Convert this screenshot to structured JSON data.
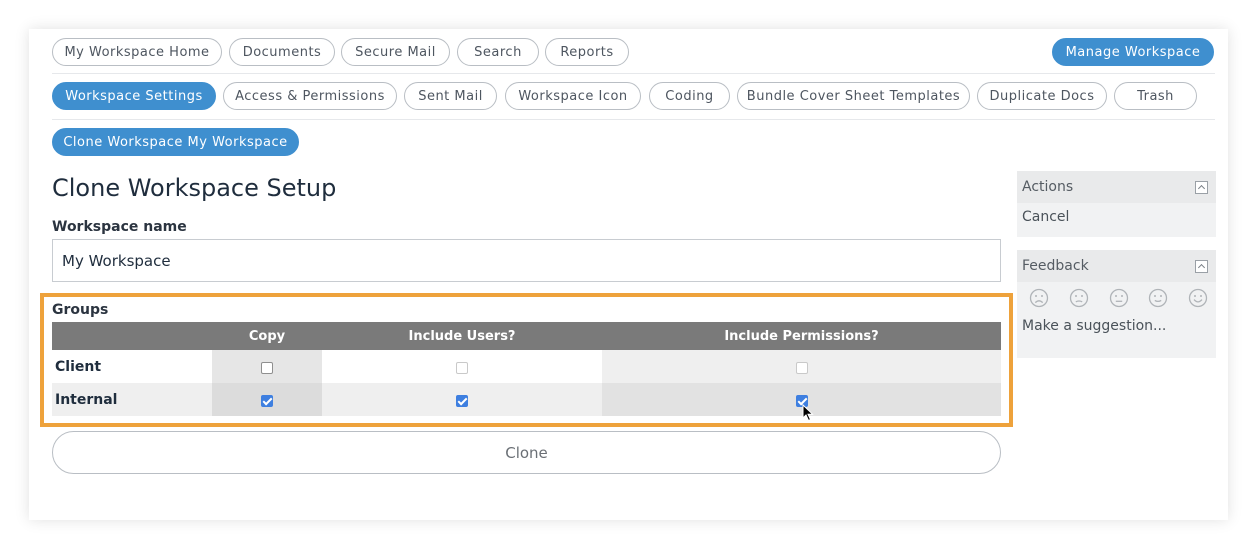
{
  "nav_row1": {
    "tabs": [
      "My Workspace Home",
      "Documents",
      "Secure Mail",
      "Search",
      "Reports"
    ],
    "manage_button": "Manage Workspace"
  },
  "nav_row2": {
    "tabs": [
      "Workspace Settings",
      "Access & Permissions",
      "Sent Mail",
      "Workspace Icon",
      "Coding",
      "Bundle Cover Sheet Templates",
      "Duplicate Docs",
      "Trash"
    ],
    "active": "Workspace Settings"
  },
  "nav_row3": {
    "tab": "Clone Workspace My Workspace"
  },
  "main": {
    "title": "Clone Workspace Setup",
    "workspace_name_label": "Workspace name",
    "workspace_name_value": "My Workspace",
    "groups_label": "Groups",
    "table": {
      "headers": [
        "",
        "Copy",
        "Include Users?",
        "Include Permissions?"
      ],
      "rows": [
        {
          "name": "Client",
          "copy": false,
          "include_users": false,
          "include_permissions": false
        },
        {
          "name": "Internal",
          "copy": true,
          "include_users": true,
          "include_permissions": true
        }
      ]
    },
    "clone_button": "Clone"
  },
  "actions_panel": {
    "title": "Actions",
    "items": [
      "Cancel"
    ]
  },
  "feedback_panel": {
    "title": "Feedback",
    "faces": [
      "very-unhappy-face-icon",
      "unhappy-face-icon",
      "neutral-face-icon",
      "happy-face-icon",
      "very-happy-face-icon"
    ],
    "suggestion_link": "Make a suggestion..."
  },
  "colors": {
    "accent": "#3f8fcf",
    "highlight": "#eea23b",
    "table_header": "#7a7a7a",
    "checkbox_checked": "#3e7fe0"
  }
}
